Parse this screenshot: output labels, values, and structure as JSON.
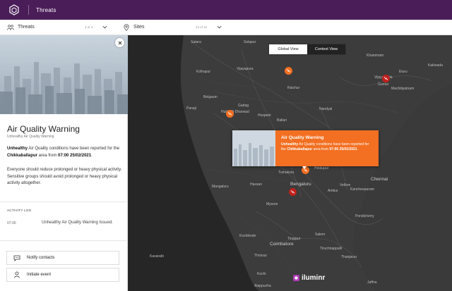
{
  "app": {
    "title": "Threats"
  },
  "filters": {
    "threats": {
      "label": "Threats",
      "count": "4 of 4"
    },
    "sites": {
      "label": "Sites",
      "count": "44 of 44"
    }
  },
  "panel": {
    "title": "Air Quality Warning",
    "subtitle": "Unhealthy Air Quality Warning",
    "body": {
      "level": "Unhealthy",
      "text1": " Air Quality conditions have been reported for the ",
      "location": "Chikkaballapur",
      "text2": " area from ",
      "datetime": "07:00 25/02/2021",
      "text3": "."
    },
    "advice_lines": [
      "Everyone should reduce prolonged or heavy physical activity.",
      "Sensitive groups should avoid prolonged or heavy physical activity altogether."
    ],
    "activity_log": {
      "title": "ACTIVITY LOG",
      "entries": [
        {
          "time": "07:00",
          "text": "Unhealthy Air Quality Warning Issued."
        }
      ]
    },
    "actions": {
      "notify": "Notify contacts",
      "initiate": "Initiate event"
    }
  },
  "map": {
    "view_toggle": {
      "global": "Global View",
      "context": "Context View",
      "selected": "Context View"
    },
    "popup": {
      "title": "Air Quality Warning",
      "level": "Unhealthy",
      "text1": " Air Quality conditions have been reported for the ",
      "location": "Chikkaballapur",
      "text2": " area from ",
      "datetime": "07:00 25/02/2021",
      "text3": "."
    },
    "places": {
      "satara": "Satara",
      "solapur": "Solapur",
      "khammam": "Khammam",
      "kakinada": "Kakinada",
      "eluru": "Eluru",
      "vijayawada": "Vijayawada",
      "guntur": "Guntur",
      "machilipatnam": "Machilipatnam",
      "kolhapur": "Kolhapur",
      "vijayapura": "Vijayapura",
      "raichur": "Raichur",
      "belgaum": "Belgaum",
      "panaji": "Panaji",
      "gadag": "Gadag",
      "hubballi": "Hubballi-Dharwad",
      "hospete": "Hospete",
      "nandyal": "Nandyal",
      "ballari": "Ballari",
      "tumakuru": "Tumakuru",
      "hindupur": "Hindupur",
      "chennai": "Chennai",
      "mangaluru": "Mangaluru",
      "hassan": "Hassan",
      "bengaluru": "Bengaluru",
      "ambur": "Ambur",
      "vellore": "Vellore",
      "kancheepuram": "Kancheepuram",
      "mysore": "Mysore",
      "pondicherry": "Pondicherry",
      "kozhikode": "Kozhikode",
      "tiruppur": "Tiruppur",
      "salem": "Salem",
      "coimbatore": "Coimbatore",
      "thrissur": "Thrissur",
      "tiruchirappalli": "Tiruchirappalli",
      "thanjavur": "Thanjavur",
      "kavaratti": "Kavaratti",
      "kochi": "Kochi",
      "alappuzha": "Alappuzha",
      "jaffna": "Jaffna"
    },
    "brand": "iluminr"
  },
  "colors": {
    "topbar": "#4a1d59",
    "accent": "#f36f21",
    "alert_red": "#c0201d",
    "map_bg": "#2b2b2b"
  }
}
